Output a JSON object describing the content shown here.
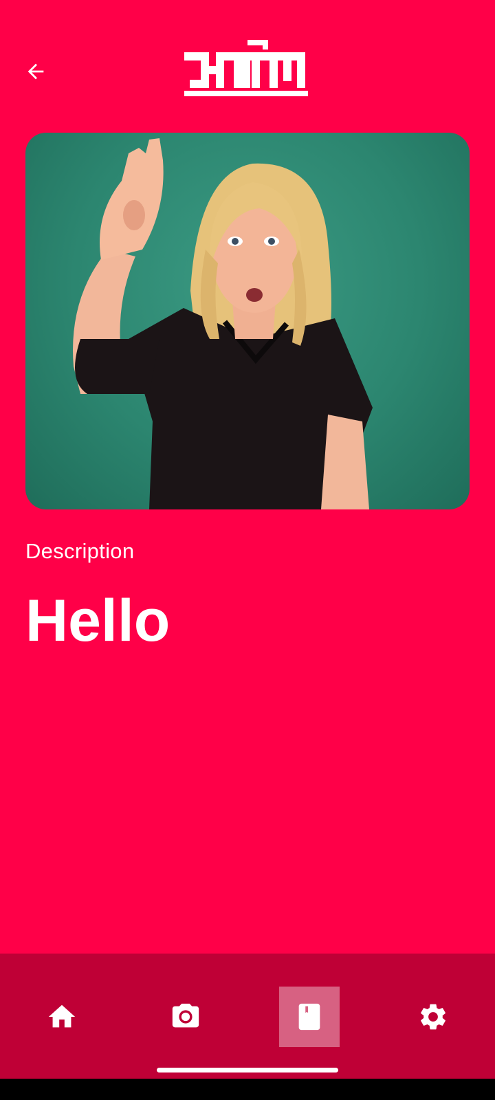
{
  "header": {
    "back_icon": "arrow-left-icon",
    "logo_text": "သင်္ကေတ"
  },
  "content": {
    "description_label": "Description",
    "word": "Hello"
  },
  "bottom_nav": {
    "items": [
      {
        "icon": "home-icon",
        "active": false
      },
      {
        "icon": "camera-icon",
        "active": false
      },
      {
        "icon": "book-icon",
        "active": true
      },
      {
        "icon": "gear-icon",
        "active": false
      }
    ]
  },
  "colors": {
    "background": "#ff0048",
    "nav_background": "#bf0036",
    "text": "#ffffff",
    "video_background": "#2c8670"
  }
}
